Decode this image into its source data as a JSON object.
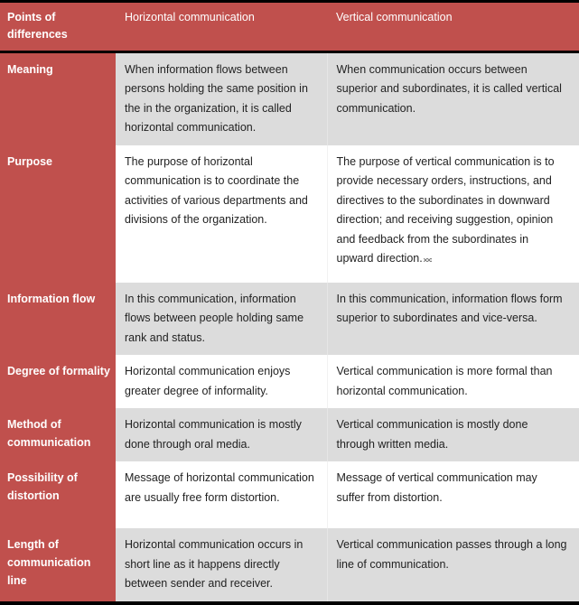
{
  "table": {
    "accent_color": "#c0504d",
    "header_text_color": "#ffffff",
    "shaded_band_color": "#dcdcdc",
    "plain_band_color": "#ffffff",
    "border_color": "#000000",
    "header": {
      "term_label": "Points of differences",
      "col1_label": "Horizontal communication",
      "col2_label": "Vertical communication"
    },
    "rows": [
      {
        "term": "Meaning",
        "horizontal": "When information flows between persons holding the same position in the in the organization, it is called horizontal communication.",
        "vertical": "When communication occurs between superior and subordinates, it is called vertical communication."
      },
      {
        "term": "Purpose",
        "horizontal": "The purpose of horizontal communication is to coordinate the activities of various departments and divisions of the organization.",
        "vertical": "The purpose of vertical communication is to provide necessary orders, instructions, and directives to the subordinates in downward direction; and receiving suggestion, opinion and feedback from the subordinates in upward direction."
      },
      {
        "term": "Information flow",
        "horizontal": "In this communication, information flows between people holding same rank and status.",
        "vertical": "In this communication, information flows form superior to subordinates and vice-versa."
      },
      {
        "term": "Degree of formality",
        "horizontal": "Horizontal communication enjoys greater degree of informality.",
        "vertical": "Vertical communication is more formal than horizontal communication."
      },
      {
        "term": "Method of communication",
        "horizontal": "Horizontal communication is mostly done through oral media.",
        "vertical": "Vertical communication is mostly done through written media."
      },
      {
        "term": "Possibility of distortion",
        "horizontal": "Message of horizontal communication are usually free form distortion.",
        "vertical": "Message of vertical communication may suffer from distortion."
      },
      {
        "term": "Length of communication line",
        "horizontal": "Horizontal communication occurs in short line as it happens directly between sender and receiver.",
        "vertical": "Vertical communication passes through a long line of communication."
      }
    ]
  }
}
